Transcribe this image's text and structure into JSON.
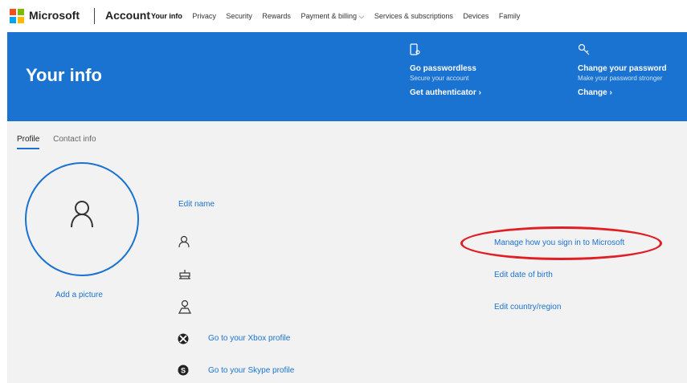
{
  "nav": {
    "brand": "Microsoft",
    "section": "Account",
    "links": [
      "Your info",
      "Privacy",
      "Security",
      "Rewards",
      "Payment & billing ⌵",
      "Services & subscriptions",
      "Devices",
      "Family"
    ],
    "logo_colors": [
      "#f25022",
      "#7fba00",
      "#00a4ef",
      "#ffb900"
    ]
  },
  "banner": {
    "title": "Your info",
    "bg_color": "#1a73d1",
    "promo_passwordless": {
      "icon": "phone-key-icon",
      "heading": "Go passwordless",
      "sub": "Secure your account",
      "link": "Get authenticator ›"
    },
    "promo_password": {
      "icon": "key-icon",
      "heading": "Change your password",
      "sub": "Make your password stronger",
      "link": "Change ›"
    }
  },
  "tabs": [
    "Profile",
    "Contact info"
  ],
  "profile": {
    "add_picture": "Add a picture",
    "edit_name": "Edit name",
    "xbox_link": "Go to your Xbox profile",
    "skype_link": "Go to your Skype profile"
  },
  "right_links": {
    "manage_signin": "Manage how you sign in to Microsoft",
    "edit_dob": "Edit date of birth",
    "edit_country": "Edit country/region"
  },
  "annotation_color": "#e01e24"
}
